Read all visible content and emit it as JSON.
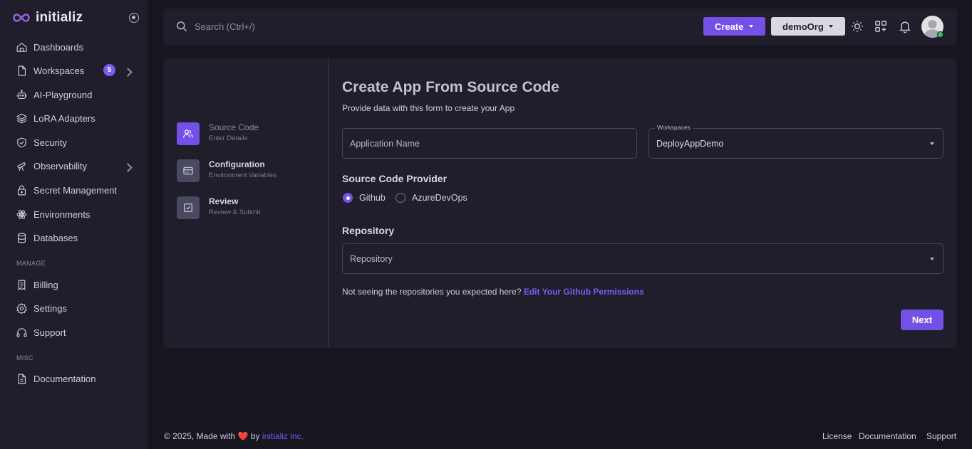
{
  "brand": {
    "name": "initializ"
  },
  "sidebar": {
    "items": [
      {
        "label": "Dashboards"
      },
      {
        "label": "Workspaces",
        "badge": "5"
      },
      {
        "label": "AI-Playground"
      },
      {
        "label": "LoRA Adapters"
      },
      {
        "label": "Security"
      },
      {
        "label": "Observability"
      },
      {
        "label": "Secret Management"
      },
      {
        "label": "Environments"
      },
      {
        "label": "Databases"
      }
    ],
    "manage_label": "MANAGE",
    "manage_items": [
      {
        "label": "Billing"
      },
      {
        "label": "Settings"
      },
      {
        "label": "Support"
      }
    ],
    "misc_label": "MISC",
    "misc_items": [
      {
        "label": "Documentation"
      }
    ]
  },
  "topbar": {
    "search_placeholder": "Search (Ctrl+/)",
    "create_label": "Create",
    "org_label": "demoOrg"
  },
  "stepper": {
    "steps": [
      {
        "title": "Source Code",
        "subtitle": "Enter Details"
      },
      {
        "title": "Configuration",
        "subtitle": "Environment Variables"
      },
      {
        "title": "Review",
        "subtitle": "Review & Submit"
      }
    ]
  },
  "form": {
    "title": "Create App From Source Code",
    "subtitle": "Provide data with this form to create your App",
    "app_name_placeholder": "Application Name",
    "workspace_label": "Workspaces",
    "workspace_value": "DeployAppDemo",
    "provider_title": "Source Code Provider",
    "provider_options": [
      "Github",
      "AzureDevOps"
    ],
    "repository_title": "Repository",
    "repository_placeholder": "Repository",
    "hint_text": "Not seeing the repositories you expected here?",
    "hint_link": "Edit Your Github Permissions",
    "next_label": "Next"
  },
  "footer": {
    "copyright_prefix": "© 2025, Made with",
    "by_text": "by",
    "company": "initializ inc.",
    "links": [
      "License",
      "Documentation",
      "Support"
    ]
  },
  "colors": {
    "accent": "#7451e6",
    "background": "#17151f",
    "panel": "#201e2b",
    "online": "#28c76f"
  }
}
